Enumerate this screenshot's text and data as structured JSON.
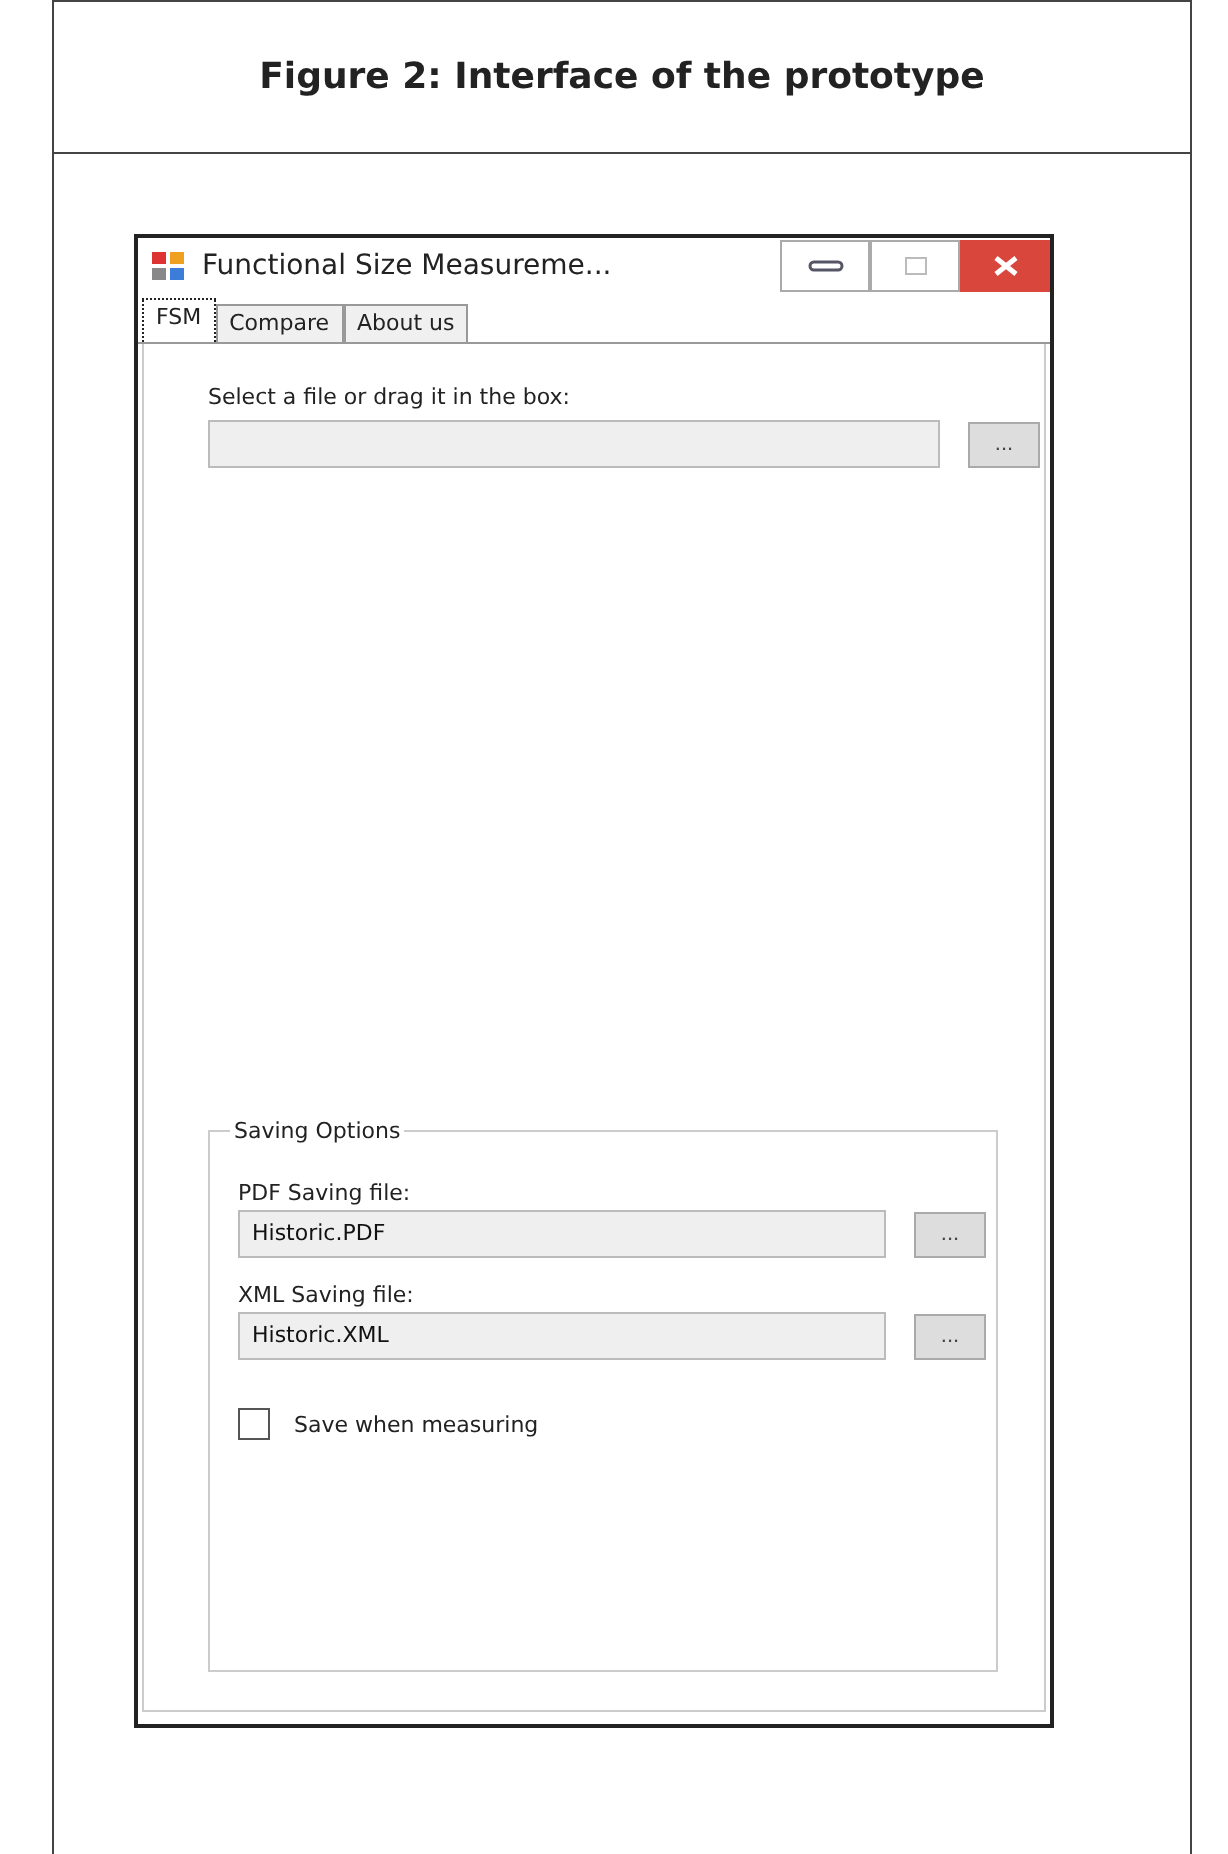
{
  "figure": {
    "caption": "Figure 2: Interface of the prototype"
  },
  "window": {
    "title": "Functional Size Measureme..."
  },
  "tabs": [
    {
      "label": "FSM",
      "selected": true
    },
    {
      "label": "Compare",
      "selected": false
    },
    {
      "label": "About us",
      "selected": false
    }
  ],
  "file_select": {
    "label": "Select a file or drag it in the box:",
    "button": "..."
  },
  "saving_options": {
    "title": "Saving Options",
    "fields": [
      {
        "label": "PDF Saving file:",
        "value": "Historic.PDF",
        "button": "..."
      },
      {
        "label": "XML Saving file:",
        "value": "Historic.XML",
        "button": "..."
      }
    ],
    "checkbox": {
      "label": "Save when measuring",
      "checked": false
    }
  }
}
